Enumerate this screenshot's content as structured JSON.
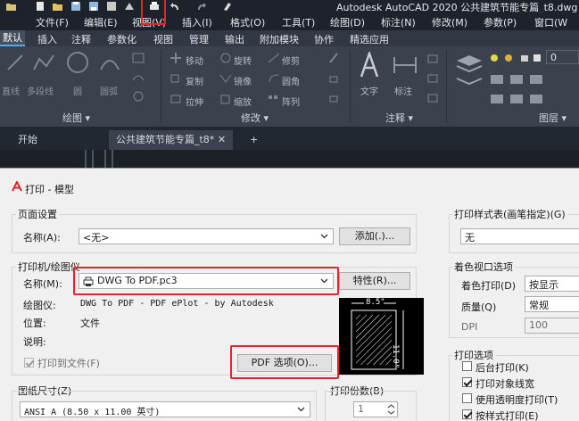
{
  "window": {
    "title": "Autodesk AutoCAD 2020    公共建筑节能专篇_t8.dwg"
  },
  "menu": [
    "文件(F)",
    "编辑(E)",
    "视图(V)",
    "插入(I)",
    "格式(O)",
    "工具(T)",
    "绘图(D)",
    "标注(N)",
    "修改(M)",
    "参数(P)",
    "窗口(W"
  ],
  "ribbon_tabs": [
    "默认",
    "插入",
    "注释",
    "参数化",
    "视图",
    "管理",
    "输出",
    "附加模块",
    "协作",
    "精选应用"
  ],
  "ribbon": {
    "draw_tools": [
      "直线",
      "多段线",
      "圆",
      "圆弧"
    ],
    "modify_tools": [
      "移动",
      "旋转",
      "修剪",
      "复制",
      "镜像",
      "圆角",
      "拉伸",
      "缩放",
      "阵列"
    ],
    "annotation_tools": [
      "文字",
      "标注"
    ],
    "layer_value": "0",
    "panels": [
      "绘图",
      "修改",
      "注释",
      "图层"
    ]
  },
  "doc_tabs": {
    "start": "开始",
    "active": "公共建筑节能专篇_t8*",
    "close": "✕",
    "add": "+"
  },
  "dialog": {
    "title": "打印 - 模型",
    "page_setup": {
      "group": "页面设置",
      "name_label": "名称(A):",
      "name_value": "<无>",
      "add_button": "添加(.)..."
    },
    "printer": {
      "group": "打印机/绘图仪",
      "name_label": "名称(M):",
      "name_value": "DWG To PDF.pc3",
      "properties_button": "特性(R)...",
      "plotter_label": "绘图仪:",
      "plotter_value": "DWG To PDF - PDF ePlot - by Autodesk",
      "where_label": "位置:",
      "where_value": "文件",
      "description_label": "说明:",
      "plot_to_file": "打印到文件(F)",
      "pdf_options_button": "PDF 选项(O)...",
      "preview_width": "8.5\"",
      "preview_height": "11.0\""
    },
    "paper_size": {
      "group": "图纸尺寸(Z)",
      "value": "ANSI A (8.50 x 11.00 英寸)"
    },
    "copies": {
      "group": "打印份数(B)",
      "value": "1"
    },
    "plot_style": {
      "group": "打印样式表(画笔指定)(G)",
      "value": "无"
    },
    "shaded_viewport": {
      "group": "着色视口选项",
      "shade_label": "着色打印(D)",
      "shade_value": "按显示",
      "quality_label": "质量(Q)",
      "quality_value": "常规",
      "dpi_label": "DPI",
      "dpi_value": "100"
    },
    "plot_options": {
      "group": "打印选项",
      "items": [
        {
          "label": "后台打印(K)",
          "checked": false
        },
        {
          "label": "打印对象线宽",
          "checked": true
        },
        {
          "label": "使用透明度打印(T)",
          "checked": false
        },
        {
          "label": "按样式打印(E)",
          "checked": true
        }
      ]
    }
  },
  "colors": {
    "highlight": "#e0262b",
    "chrome": "#2b2f37",
    "accent": "#58a8e8"
  }
}
